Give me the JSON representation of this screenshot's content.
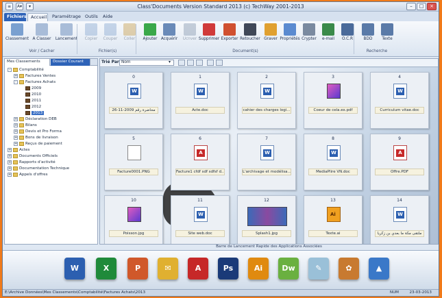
{
  "window": {
    "title": "Class'Documents Version Standard 2013 (c) TechWay 2001-2013"
  },
  "quick_access": [
    "≡",
    "A▾",
    "▾"
  ],
  "tabs": [
    {
      "label": "Fichiers",
      "style": "file"
    },
    {
      "label": "Accueil",
      "style": "active"
    },
    {
      "label": "Paramétrage",
      "style": ""
    },
    {
      "label": "Outils",
      "style": ""
    },
    {
      "label": "Aide",
      "style": ""
    }
  ],
  "ribbon": {
    "buttons": [
      {
        "label": "Classement",
        "icon": "classement-icon",
        "disabled": false,
        "color": "#7aa0d0"
      },
      {
        "label": "A Classer",
        "icon": "a-classer-icon",
        "disabled": false,
        "color": "#a8bcd8"
      },
      {
        "label": "Lancement",
        "icon": "lancement-icon",
        "disabled": false,
        "color": "#a8bcd8"
      },
      {
        "label": "Copier",
        "icon": "copy-icon",
        "disabled": true,
        "color": "#8aa8d0"
      },
      {
        "label": "Couper",
        "icon": "cut-icon",
        "disabled": true,
        "color": "#8aa8d0"
      },
      {
        "label": "Coller",
        "icon": "paste-icon",
        "disabled": true,
        "color": "#c8a050"
      },
      {
        "label": "Ajouter",
        "icon": "add-icon",
        "disabled": false,
        "color": "#3aa84a"
      },
      {
        "label": "Acquérir",
        "icon": "acquire-icon",
        "disabled": false,
        "color": "#6a8ab8"
      },
      {
        "label": "Ucnver",
        "icon": "unlock-icon",
        "disabled": true,
        "color": "#8898b0"
      },
      {
        "label": "Supprimer",
        "icon": "delete-icon",
        "disabled": false,
        "color": "#d03a3a"
      },
      {
        "label": "Exporter",
        "icon": "export-icon",
        "disabled": false,
        "color": "#d05030"
      },
      {
        "label": "Retoucher",
        "icon": "retouch-icon",
        "disabled": false,
        "color": "#404858"
      },
      {
        "label": "Graver",
        "icon": "burn-icon",
        "disabled": false,
        "color": "#e0a030"
      },
      {
        "label": "Propriétés",
        "icon": "properties-icon",
        "disabled": false,
        "color": "#5a8ad0"
      },
      {
        "label": "Crypter",
        "icon": "encrypt-icon",
        "disabled": false,
        "color": "#7a8aa0"
      },
      {
        "label": "e-mail",
        "icon": "email-icon",
        "disabled": false,
        "color": "#3a8a4a"
      },
      {
        "label": "O.C.R",
        "icon": "ocr-icon",
        "disabled": false,
        "color": "#4a6a9a"
      },
      {
        "label": "BDD",
        "icon": "search-db-icon",
        "disabled": false,
        "color": "#5a7aa8"
      },
      {
        "label": "Texte",
        "icon": "search-text-icon",
        "disabled": false,
        "color": "#5a7aa8"
      }
    ],
    "groups": [
      "Voir / Cacher",
      "Fichier(s)",
      "Document(s)",
      "Recherche"
    ]
  },
  "left_panel": {
    "tabs": [
      "Mes Classements",
      "Dossier Courant"
    ],
    "tree": [
      {
        "label": "Comptabilité",
        "level": 0,
        "toggle": "-",
        "folder": "yellow",
        "selected": false
      },
      {
        "label": "Factures Ventes",
        "level": 1,
        "toggle": "+",
        "folder": "yellow",
        "selected": false
      },
      {
        "label": "Factures Achats",
        "level": 1,
        "toggle": "-",
        "folder": "yellow",
        "selected": false
      },
      {
        "label": "2009",
        "level": 2,
        "toggle": "",
        "folder": "dark",
        "selected": false
      },
      {
        "label": "2010",
        "level": 2,
        "toggle": "",
        "folder": "dark",
        "selected": false
      },
      {
        "label": "2011",
        "level": 2,
        "toggle": "",
        "folder": "dark",
        "selected": false
      },
      {
        "label": "2012",
        "level": 2,
        "toggle": "",
        "folder": "dark",
        "selected": false
      },
      {
        "label": "2013",
        "level": 2,
        "toggle": "",
        "folder": "dark",
        "selected": true
      },
      {
        "label": "Déclaration DEB",
        "level": 1,
        "toggle": "+",
        "folder": "yellow",
        "selected": false
      },
      {
        "label": "Bilans",
        "level": 1,
        "toggle": "+",
        "folder": "yellow",
        "selected": false
      },
      {
        "label": "Devis et Pro Forma",
        "level": 1,
        "toggle": "+",
        "folder": "yellow",
        "selected": false
      },
      {
        "label": "Bons de livraison",
        "level": 1,
        "toggle": "+",
        "folder": "yellow",
        "selected": false
      },
      {
        "label": "Reçus de paiement",
        "level": 1,
        "toggle": "+",
        "folder": "yellow",
        "selected": false
      },
      {
        "label": "Actes",
        "level": 0,
        "toggle": "+",
        "folder": "yellow",
        "selected": false
      },
      {
        "label": "Documents Officiels",
        "level": 0,
        "toggle": "+",
        "folder": "yellow",
        "selected": false
      },
      {
        "label": "Rapports d'activité",
        "level": 0,
        "toggle": "+",
        "folder": "yellow",
        "selected": false
      },
      {
        "label": "Documentation Technique",
        "level": 0,
        "toggle": "+",
        "folder": "yellow",
        "selected": false
      },
      {
        "label": "Appels d'offres",
        "level": 0,
        "toggle": "+",
        "folder": "yellow",
        "selected": false
      }
    ]
  },
  "right_panel": {
    "sort_label": "Trié Par",
    "sort_value": "Nom",
    "cards": [
      {
        "num": "0",
        "caption": "26-11-2009 محاضرة رقم",
        "type": "doc"
      },
      {
        "num": "1",
        "caption": "Acte.doc",
        "type": "doc"
      },
      {
        "num": "2",
        "caption": "cahier des charges logi...",
        "type": "doc"
      },
      {
        "num": "3",
        "caption": "Coeur de cela.ex.pdf",
        "type": "img"
      },
      {
        "num": "4",
        "caption": "Curriculum vitae.doc",
        "type": "doc"
      },
      {
        "num": "5",
        "caption": "Facture0001.PNG",
        "type": "png"
      },
      {
        "num": "6",
        "caption": "Facture1 cfdf sdf sdfsf d...",
        "type": "pdf"
      },
      {
        "num": "7",
        "caption": "L'archivage et modélisa...",
        "type": "doc"
      },
      {
        "num": "8",
        "caption": "MediaPlire VN.doc",
        "type": "doc"
      },
      {
        "num": "9",
        "caption": "Offre.PDF",
        "type": "pdf"
      },
      {
        "num": "10",
        "caption": "Poisson.jpg",
        "type": "img"
      },
      {
        "num": "11",
        "caption": "Site web.doc",
        "type": "doc"
      },
      {
        "num": "12",
        "caption": "Splash1.jpg",
        "type": "wide"
      },
      {
        "num": "13",
        "caption": "Texte.ai",
        "type": "ai"
      },
      {
        "num": "14",
        "caption": "ملتقى مكة ما بعدي بن زكريا",
        "type": "doc"
      }
    ]
  },
  "launch_bar": {
    "title": "Barre de Lancement Rapide des Applications Associées",
    "apps": [
      {
        "name": "word-icon",
        "color": "#2c5fb0",
        "glyph": "W"
      },
      {
        "name": "excel-icon",
        "color": "#1f8a3a",
        "glyph": "X"
      },
      {
        "name": "powerpoint-icon",
        "color": "#d0582a",
        "glyph": "P"
      },
      {
        "name": "outlook-icon",
        "color": "#e0b030",
        "glyph": "✉"
      },
      {
        "name": "acrobat-icon",
        "color": "#c62828",
        "glyph": "A"
      },
      {
        "name": "photoshop-icon",
        "color": "#1a3a78",
        "glyph": "Ps"
      },
      {
        "name": "illustrator-icon",
        "color": "#e08a10",
        "glyph": "Ai"
      },
      {
        "name": "dreamweaver-icon",
        "color": "#6ab040",
        "glyph": "Dw"
      },
      {
        "name": "notepad-icon",
        "color": "#9ac0d8",
        "glyph": "✎"
      },
      {
        "name": "paint-icon",
        "color": "#c87a30",
        "glyph": "✿"
      },
      {
        "name": "paint-bucket-icon",
        "color": "#3a78c8",
        "glyph": "▲"
      }
    ]
  },
  "status": {
    "path": "E:\\Archive Données\\Mes Classements\\Comptabilité\\Factures Achats\\2013",
    "num": "NUM",
    "date": "23-03-2013"
  }
}
